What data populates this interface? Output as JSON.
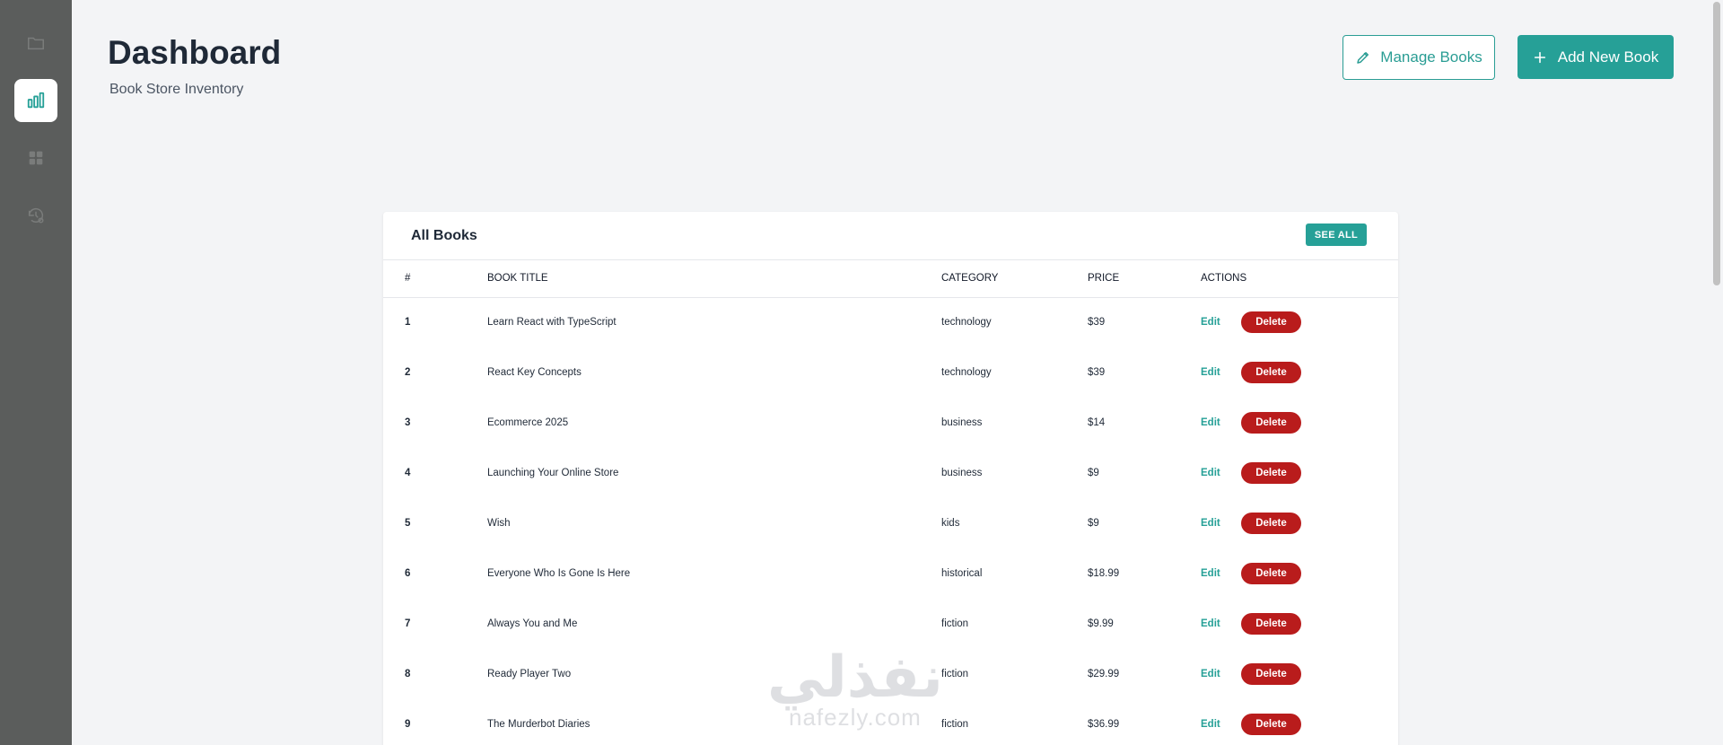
{
  "sidebar": {
    "items": [
      {
        "icon": "folder-icon",
        "active": false
      },
      {
        "icon": "bar-chart-icon",
        "active": true
      },
      {
        "icon": "grid-icon",
        "active": false
      },
      {
        "icon": "history-settings-icon",
        "active": false
      }
    ]
  },
  "header": {
    "title": "Dashboard",
    "subtitle": "Book Store Inventory",
    "manage_label": "Manage Books",
    "add_label": "Add New Book"
  },
  "colors": {
    "accent": "#26a097",
    "danger": "#b91c1c",
    "sidebar": "#5b5d5c",
    "background": "#f3f4f6"
  },
  "books_table": {
    "title": "All Books",
    "see_all_label": "SEE ALL",
    "columns": [
      "#",
      "BOOK TITLE",
      "CATEGORY",
      "PRICE",
      "ACTIONS"
    ],
    "edit_label": "Edit",
    "delete_label": "Delete",
    "rows": [
      {
        "num": "1",
        "title": "Learn React with TypeScript",
        "category": "technology",
        "price": "$39"
      },
      {
        "num": "2",
        "title": "React Key Concepts",
        "category": "technology",
        "price": "$39"
      },
      {
        "num": "3",
        "title": "Ecommerce 2025",
        "category": "business",
        "price": "$14"
      },
      {
        "num": "4",
        "title": "Launching Your Online Store",
        "category": "business",
        "price": "$9"
      },
      {
        "num": "5",
        "title": "Wish",
        "category": "kids",
        "price": "$9"
      },
      {
        "num": "6",
        "title": "Everyone Who Is Gone Is Here",
        "category": "historical",
        "price": "$18.99"
      },
      {
        "num": "7",
        "title": "Always You and Me",
        "category": "fiction",
        "price": "$9.99"
      },
      {
        "num": "8",
        "title": "Ready Player Two",
        "category": "fiction",
        "price": "$29.99"
      },
      {
        "num": "9",
        "title": "The Murderbot Diaries",
        "category": "fiction",
        "price": "$36.99"
      }
    ]
  },
  "watermark": {
    "logo": "نفذلي",
    "url": "nafezly.com"
  }
}
